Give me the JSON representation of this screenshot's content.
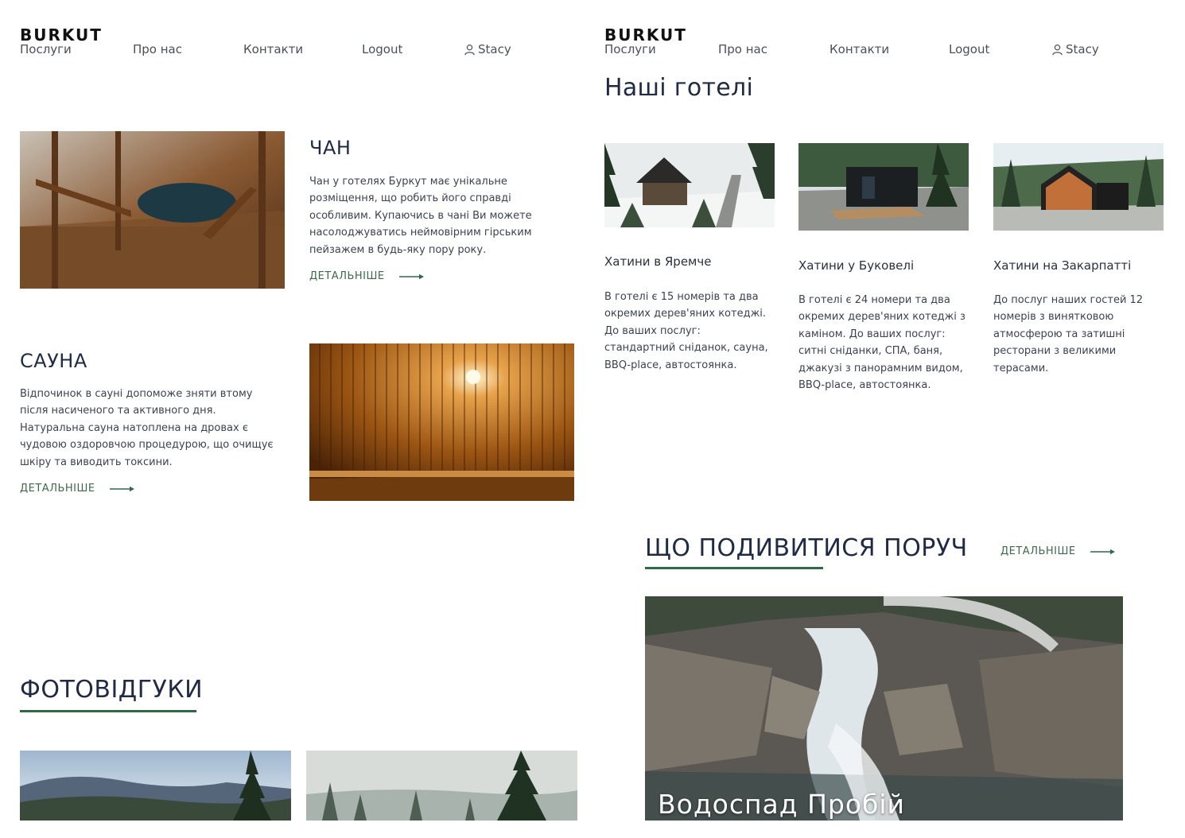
{
  "header": {
    "logo": "BURKUT",
    "nav": [
      "Послуги",
      "Про нас",
      "Контакти",
      "Logout"
    ],
    "user": "Stacy",
    "user_icon": "user-icon"
  },
  "services": [
    {
      "title": "ЧАН",
      "text": "Чан у готелях Буркут має унікальне розміщення, що робить його справді особливим. Купаючись в чані Ви можете насолоджуватись неймовірним гірським пейзажем в будь-яку пору року.",
      "more": "ДЕТАЛЬНІШЕ"
    },
    {
      "title": "САУНА",
      "text": "Відпочинок в сауні допоможе зняти втому після насиченого та активного дня. Натуральна сауна натоплена на дровах є чудовою оздоровчою процедурою, що очищує шкіру та виводить токсини.",
      "more": "ДЕТАЛЬНІШЕ"
    }
  ],
  "photo_reviews": {
    "title": "ФОТОВІДГУКИ"
  },
  "hotels": {
    "title": "Наші готелі",
    "items": [
      {
        "name": "Хатини в Яремче",
        "text": "В готелі є 15 номерів та два окремих дерев'яних котеджі. До ваших послуг: стандартний сніданок, сауна, BBQ-place, автостоянка."
      },
      {
        "name": "Хатини у Буковелі",
        "text": "В готелі є 24 номери та два окремих дерев'яних котеджі з каміном. До ваших послуг: ситні сніданки, СПА, баня, джакузі з панорамним видом, BBQ-place, автостоянка."
      },
      {
        "name": "Хатини на Закарпатті",
        "text": "До послуг наших гостей 12 номерів з винятковою атмосферою та затишні ресторани з великими терасами."
      }
    ]
  },
  "nearby": {
    "title": "ЩО ПОДИВИТИСЯ ПОРУЧ",
    "more": "ДЕТАЛЬНІШЕ",
    "caption": "Водоспад Пробій"
  },
  "colors": {
    "accent": "#2f6a46",
    "heading": "#1f2a44",
    "text": "#3d4250"
  }
}
